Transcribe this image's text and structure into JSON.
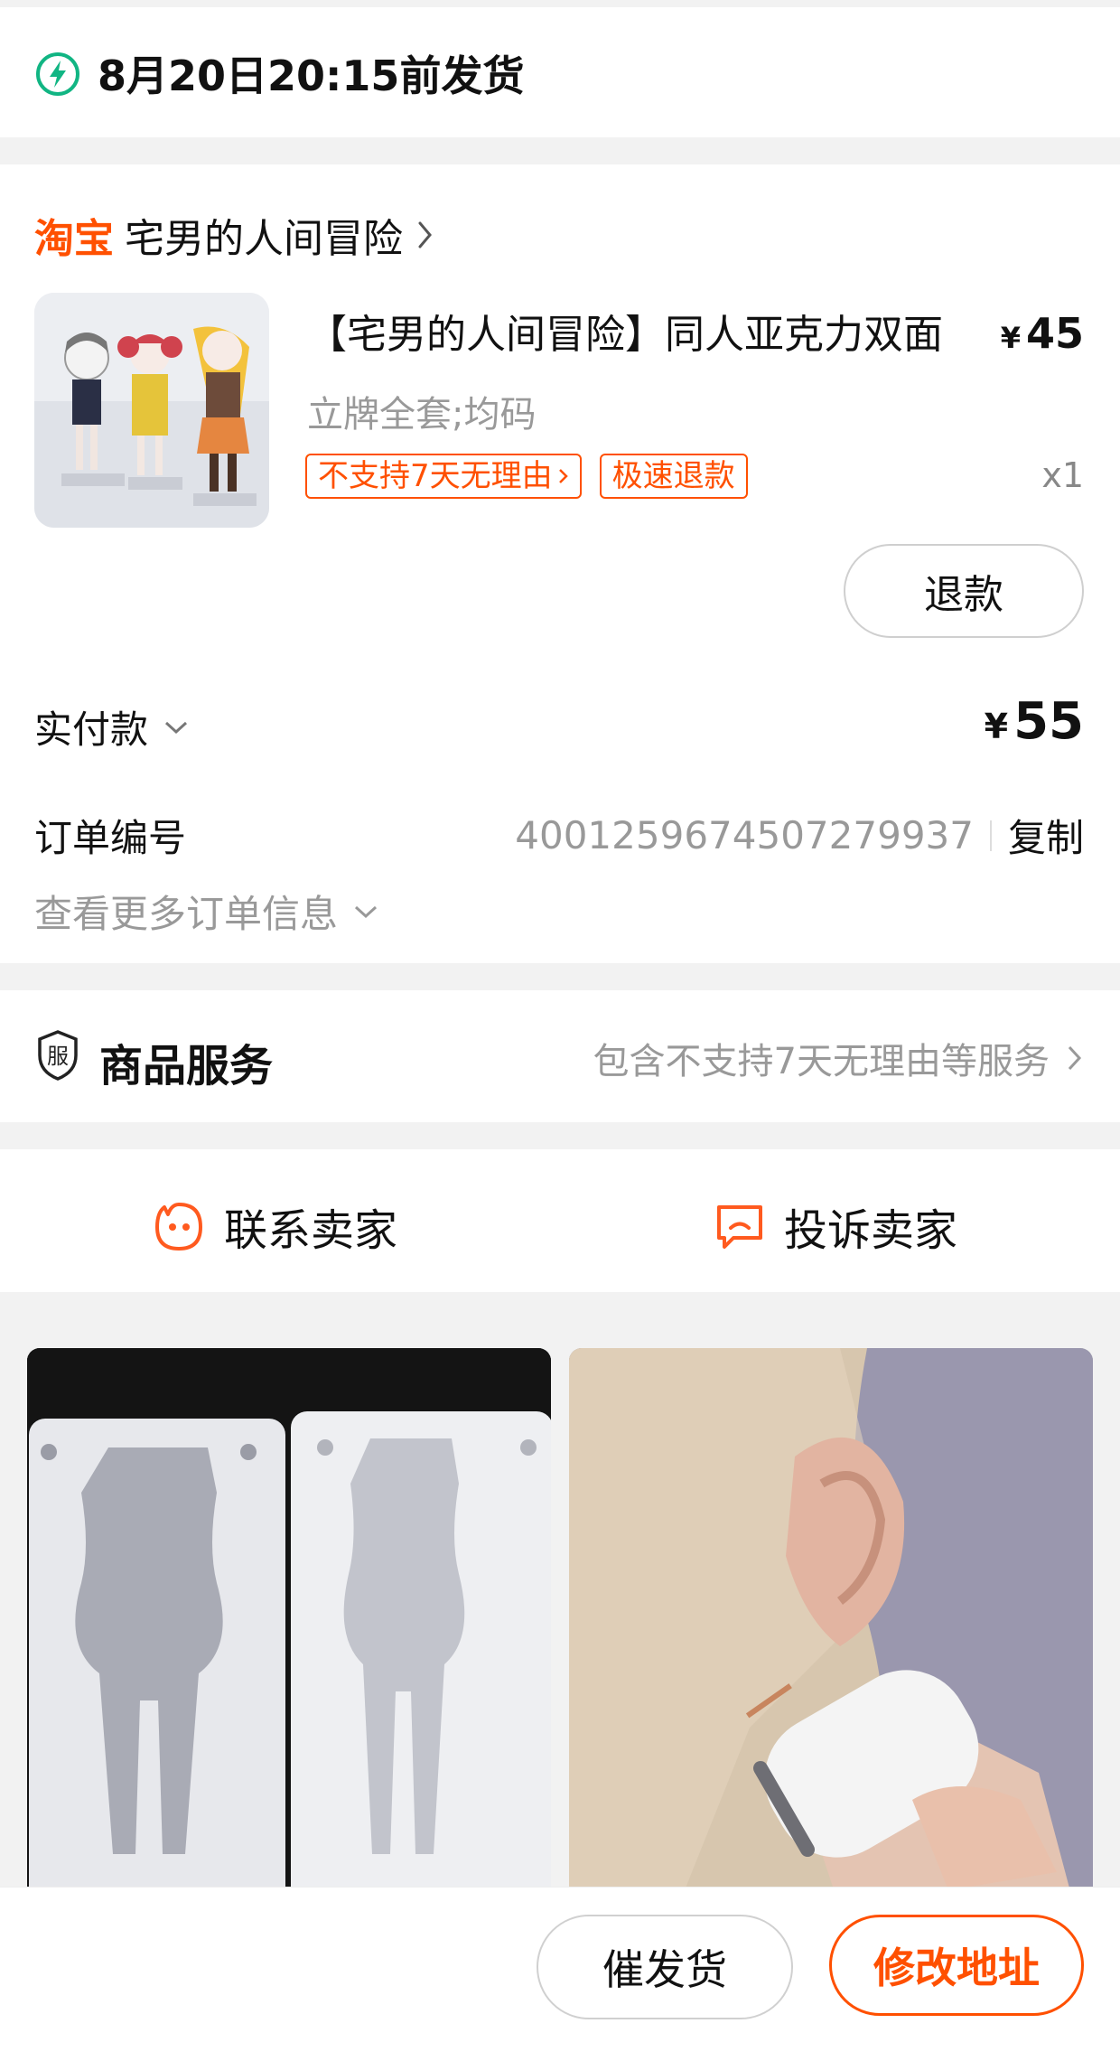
{
  "shipping": {
    "deadline_text": "8月20日20:15前发货"
  },
  "order": {
    "store": {
      "platform_logo": "淘宝",
      "name": "宅男的人间冒险"
    },
    "item": {
      "title": "【宅男的人间冒险】同人亚克力双面",
      "sku": "立牌全套;均码",
      "price_symbol": "¥",
      "price": "45",
      "tags": [
        "不支持7天无理由",
        "极速退款"
      ],
      "quantity": "x1"
    },
    "refund_label": "退款",
    "paid": {
      "label": "实付款",
      "symbol": "¥",
      "amount": "55"
    },
    "order_number": {
      "label": "订单编号",
      "value": "4001259674507279937",
      "copy_label": "复制"
    },
    "more_info_label": "查看更多订单信息"
  },
  "service": {
    "icon_char": "服",
    "title": "商品服务",
    "desc": "包含不支持7天无理由等服务"
  },
  "contact": {
    "contact_seller": "联系卖家",
    "complain_seller": "投诉卖家"
  },
  "bottom_bar": {
    "urge_label": "催发货",
    "address_label": "修改地址"
  },
  "colors": {
    "accent": "#ff5000",
    "shipping_icon": "#11b583",
    "muted": "#999999"
  }
}
